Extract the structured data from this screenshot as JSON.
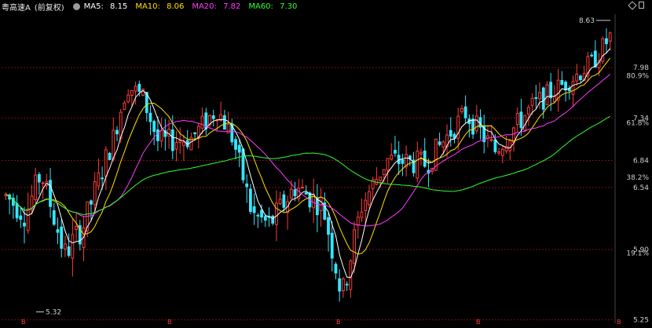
{
  "header": {
    "stock_name": "粤高速A",
    "adjust_mode": "(前复权)",
    "title_prefix": "(",
    "ma": [
      {
        "label": "MA5:",
        "value": "8.15",
        "color": "#ffffff"
      },
      {
        "label": "MA10:",
        "value": "8.06",
        "color": "#ffe000"
      },
      {
        "label": "MA20:",
        "value": "7.82",
        "color": "#ff3cff"
      },
      {
        "label": "MA60:",
        "value": "7.30",
        "color": "#2fff2f"
      }
    ]
  },
  "colors": {
    "up": "#ff3b3b",
    "down": "#35e6ff",
    "grid": "#7a1010",
    "axis_text": "#cfcfcf",
    "marker": "#cfcfcf"
  },
  "chart_data": {
    "type": "candlestick",
    "price_ticks": [
      "7.98",
      "7.34",
      "6.84",
      "6.54",
      "5.90",
      "5.25"
    ],
    "percent_ticks": [
      "80.9%",
      "61.8%",
      "38.2%",
      "19.1%"
    ],
    "price_tick_values": [
      7.98,
      7.34,
      6.84,
      6.54,
      5.9,
      5.25
    ],
    "percent_tick_values": [
      7.875,
      7.281,
      6.652,
      5.866
    ],
    "y_range": [
      5.22,
      8.72
    ],
    "high_marker": {
      "label": "8.63",
      "value": 8.63
    },
    "low_marker": {
      "label": "5.32",
      "value": 5.32
    },
    "bar_count": 164,
    "bottom_markers": [
      "B",
      "B",
      "B",
      "B",
      "B"
    ],
    "ma_series": [
      {
        "name": "MA5",
        "color": "#ffffff"
      },
      {
        "name": "MA10",
        "color": "#ffe000"
      },
      {
        "name": "MA20",
        "color": "#ff3cff"
      },
      {
        "name": "MA60",
        "color": "#2fff2f"
      }
    ]
  },
  "toolbar_icons": [
    "diamond-icon",
    "window-icon"
  ]
}
